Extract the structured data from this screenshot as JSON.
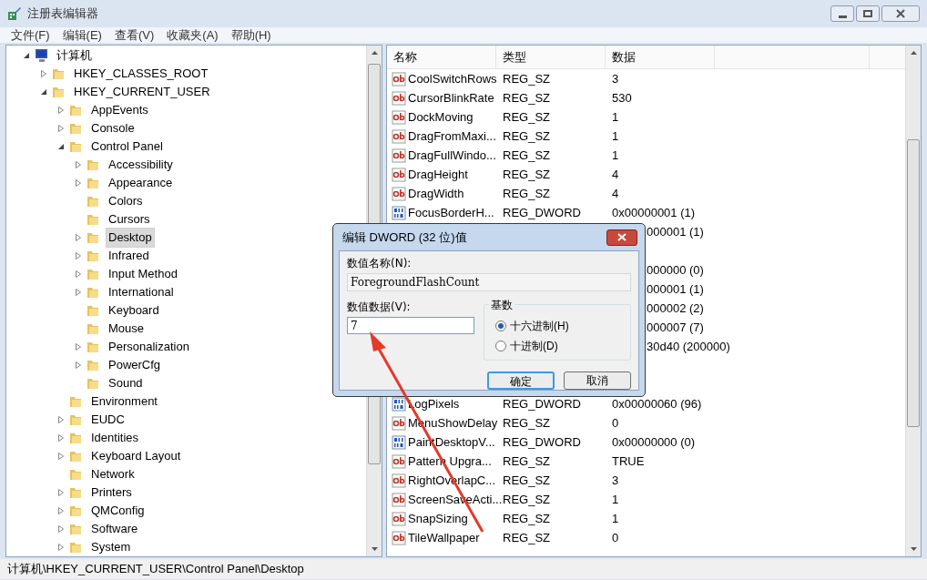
{
  "window": {
    "title": "注册表编辑器"
  },
  "menu": [
    "文件(F)",
    "编辑(E)",
    "查看(V)",
    "收藏夹(A)",
    "帮助(H)"
  ],
  "tree": [
    {
      "label": "计算机",
      "kind": "computer",
      "expanded": true,
      "selected": false,
      "children": [
        {
          "label": "HKEY_CLASSES_ROOT",
          "kind": "folder",
          "expanded": false,
          "selected": false
        },
        {
          "label": "HKEY_CURRENT_USER",
          "kind": "folder",
          "expanded": true,
          "selected": false,
          "children": [
            {
              "label": "AppEvents",
              "kind": "folder",
              "expanded": false,
              "selected": false
            },
            {
              "label": "Console",
              "kind": "folder",
              "expanded": false,
              "selected": false
            },
            {
              "label": "Control Panel",
              "kind": "folder",
              "expanded": true,
              "selected": false,
              "children": [
                {
                  "label": "Accessibility",
                  "kind": "folder",
                  "expanded": false,
                  "selected": false
                },
                {
                  "label": "Appearance",
                  "kind": "folder",
                  "expanded": false,
                  "selected": false
                },
                {
                  "label": "Colors",
                  "kind": "folder",
                  "selected": false
                },
                {
                  "label": "Cursors",
                  "kind": "folder",
                  "selected": false
                },
                {
                  "label": "Desktop",
                  "kind": "folder",
                  "expanded": false,
                  "selected": true
                },
                {
                  "label": "Infrared",
                  "kind": "folder",
                  "expanded": false,
                  "selected": false
                },
                {
                  "label": "Input Method",
                  "kind": "folder",
                  "expanded": false,
                  "selected": false
                },
                {
                  "label": "International",
                  "kind": "folder",
                  "expanded": false,
                  "selected": false
                },
                {
                  "label": "Keyboard",
                  "kind": "folder",
                  "selected": false
                },
                {
                  "label": "Mouse",
                  "kind": "folder",
                  "selected": false
                },
                {
                  "label": "Personalization",
                  "kind": "folder",
                  "expanded": false,
                  "selected": false
                },
                {
                  "label": "PowerCfg",
                  "kind": "folder",
                  "expanded": false,
                  "selected": false
                },
                {
                  "label": "Sound",
                  "kind": "folder",
                  "selected": false
                }
              ]
            },
            {
              "label": "Environment",
              "kind": "folder",
              "selected": false
            },
            {
              "label": "EUDC",
              "kind": "folder",
              "expanded": false,
              "selected": false
            },
            {
              "label": "Identities",
              "kind": "folder",
              "expanded": false,
              "selected": false
            },
            {
              "label": "Keyboard Layout",
              "kind": "folder",
              "expanded": false,
              "selected": false
            },
            {
              "label": "Network",
              "kind": "folder",
              "selected": false
            },
            {
              "label": "Printers",
              "kind": "folder",
              "expanded": false,
              "selected": false
            },
            {
              "label": "QMConfig",
              "kind": "folder",
              "expanded": false,
              "selected": false
            },
            {
              "label": "Software",
              "kind": "folder",
              "expanded": false,
              "selected": false
            },
            {
              "label": "System",
              "kind": "folder",
              "expanded": false,
              "selected": false
            }
          ]
        }
      ]
    }
  ],
  "table": {
    "columns": [
      "名称",
      "类型",
      "数据"
    ],
    "rows": [
      {
        "kind": "string",
        "name": "CoolSwitchRows",
        "type": "REG_SZ",
        "data": "3"
      },
      {
        "kind": "string",
        "name": "CursorBlinkRate",
        "type": "REG_SZ",
        "data": "530"
      },
      {
        "kind": "string",
        "name": "DockMoving",
        "type": "REG_SZ",
        "data": "1"
      },
      {
        "kind": "string",
        "name": "DragFromMaxi...",
        "type": "REG_SZ",
        "data": "1"
      },
      {
        "kind": "string",
        "name": "DragFullWindo...",
        "type": "REG_SZ",
        "data": "1"
      },
      {
        "kind": "string",
        "name": "DragHeight",
        "type": "REG_SZ",
        "data": "4"
      },
      {
        "kind": "string",
        "name": "DragWidth",
        "type": "REG_SZ",
        "data": "4"
      },
      {
        "kind": "dword",
        "name": "FocusBorderH...",
        "type": "REG_DWORD",
        "data": "0x00000001 (1)"
      },
      {
        "kind": "covered",
        "data": "000001 (1)"
      },
      {
        "kind": "covered"
      },
      {
        "kind": "covered",
        "data": "000000 (0)"
      },
      {
        "kind": "covered",
        "data": "000001 (1)"
      },
      {
        "kind": "covered",
        "data": "000002 (2)"
      },
      {
        "kind": "covered",
        "data": "000007 (7)"
      },
      {
        "kind": "covered",
        "data": "30d40 (200000)"
      },
      {
        "kind": "covered"
      },
      {
        "kind": "covered"
      },
      {
        "kind": "dword",
        "name": "LogPixels",
        "type": "REG_DWORD",
        "data": "0x00000060 (96)"
      },
      {
        "kind": "string",
        "name": "MenuShowDelay",
        "type": "REG_SZ",
        "data": "0"
      },
      {
        "kind": "dword",
        "name": "PaintDesktopV...",
        "type": "REG_DWORD",
        "data": "0x00000000 (0)"
      },
      {
        "kind": "string",
        "name": "Pattern Upgra...",
        "type": "REG_SZ",
        "data": "TRUE"
      },
      {
        "kind": "string",
        "name": "RightOverlapC...",
        "type": "REG_SZ",
        "data": "3"
      },
      {
        "kind": "string",
        "name": "ScreenSaveActi...",
        "type": "REG_SZ",
        "data": "1"
      },
      {
        "kind": "string",
        "name": "SnapSizing",
        "type": "REG_SZ",
        "data": "1"
      },
      {
        "kind": "string",
        "name": "TileWallpaper",
        "type": "REG_SZ",
        "data": "0"
      }
    ]
  },
  "status_bar": "计算机\\HKEY_CURRENT_USER\\Control Panel\\Desktop",
  "dialog": {
    "title": "编辑 DWORD (32 位)值",
    "name_label": "数值名称(N):",
    "name_value": "ForegroundFlashCount",
    "data_label": "数值数据(V):",
    "data_value": "7",
    "base_label": "基数",
    "radios": [
      {
        "label": "十六进制(H)",
        "selected": true
      },
      {
        "label": "十进制(D)",
        "selected": false
      }
    ],
    "buttons": [
      {
        "label": "确定",
        "default": true
      },
      {
        "label": "取消",
        "default": false
      }
    ]
  }
}
